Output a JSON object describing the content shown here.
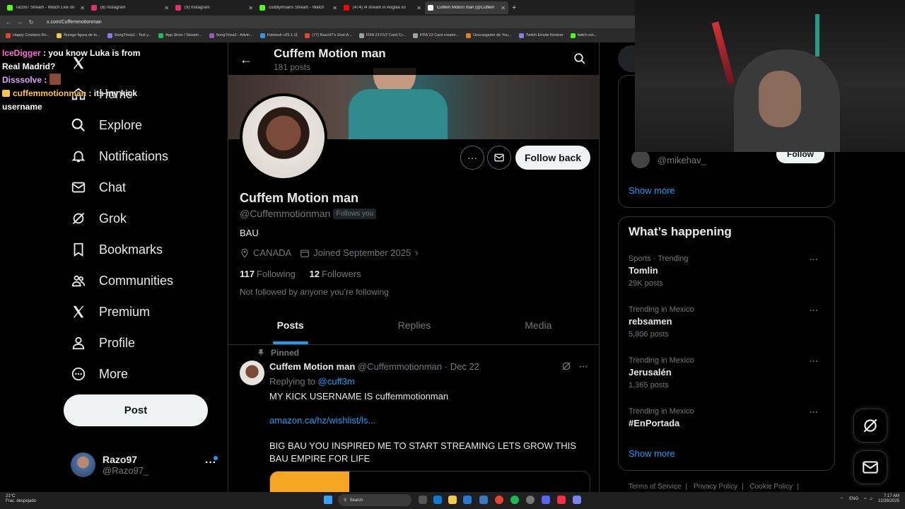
{
  "browser": {
    "tabs": [
      {
        "label": "razo97 Stream - Watch Live on",
        "color": "#53fc18",
        "active": false
      },
      {
        "label": "(6) Instagram",
        "color": "#e1306c",
        "active": false
      },
      {
        "label": "(9) Instagram",
        "color": "#e1306c",
        "active": false
      },
      {
        "label": "cuddlymoans Stream - Watch",
        "color": "#53fc18",
        "active": false
      },
      {
        "label": "(474) i4 stream in Angola xo",
        "color": "#ff0000",
        "active": false
      },
      {
        "label": "Cuffem Motion man (@Cuffem",
        "color": "#ffffff",
        "active": true
      }
    ],
    "url": "x.com/Cuffemmotionman",
    "bookmarks": [
      "Happy Cristiano Ro...",
      "Burago figura de to...",
      "SongTrivia2 - Test y...",
      "App Store / Stream...",
      "SongTrivia2 - Advin...",
      "Feletoob v25.1.11",
      "(77) Razo97's Zest-A...",
      "FIFA 23 FUT Card Cr...",
      "FIFA 23 Card creator...",
      "Descargador de You...",
      "Twitch Emote Resizer",
      "twitch em..."
    ]
  },
  "chat": [
    {
      "user": "IceDigger",
      "text": ": you know Luka is from Real Madrid?"
    },
    {
      "user": "Disssolve",
      "text": ":"
    },
    {
      "user": "cuffemmotionman",
      "text": ": its my kick username"
    }
  ],
  "nav": {
    "items": [
      {
        "label": "Home",
        "icon": "home-icon"
      },
      {
        "label": "Explore",
        "icon": "search-icon"
      },
      {
        "label": "Notifications",
        "icon": "bell-icon"
      },
      {
        "label": "Chat",
        "icon": "mail-icon"
      },
      {
        "label": "Grok",
        "icon": "grok-icon"
      },
      {
        "label": "Bookmarks",
        "icon": "bookmark-icon"
      },
      {
        "label": "Communities",
        "icon": "people-icon"
      },
      {
        "label": "Premium",
        "icon": "x-logo-icon"
      },
      {
        "label": "Profile",
        "icon": "person-icon"
      },
      {
        "label": "More",
        "icon": "more-circle-icon"
      }
    ],
    "post_label": "Post",
    "account": {
      "name": "Razo97",
      "handle": "@Razo97_"
    }
  },
  "profile": {
    "header_name": "Cuffem Motion man",
    "post_count": "181 posts",
    "name": "Cuffem Motion man",
    "handle": "@Cuffemmotionman",
    "follows_you": "Follows you",
    "bio": "BAU",
    "location": "CANADA",
    "joined": "Joined September 2025",
    "following_count": "117",
    "following_label": "Following",
    "followers_count": "12",
    "followers_label": "Followers",
    "not_followed": "Not followed by anyone you’re following",
    "follow_back": "Follow back",
    "tabs": [
      "Posts",
      "Replies",
      "Media"
    ]
  },
  "tweet": {
    "pinned": "Pinned",
    "name": "Cuffem Motion man",
    "handle": "@Cuffemmotionman",
    "sep": "·",
    "date": "Dec 22",
    "replying_prefix": "Replying to",
    "replying_to": "@cuff3m",
    "line1": "MY KICK USERNAME IS cuffemmotionman",
    "link": "amazon.ca/hz/wishlist/ls...",
    "line2": "BIG BAU YOU INSPIRED ME TO START STREAMING LETS GROW THIS BAU EMPIRE FOR LIFE"
  },
  "sidebar": {
    "who_to_follow": {
      "handle": "@mikehav_",
      "follow_label": "Follow",
      "show_more": "Show more"
    },
    "whats_happening": {
      "title": "What’s happening",
      "trends": [
        {
          "context": "Sports · Trending",
          "name": "Tomlin",
          "count": "29K posts"
        },
        {
          "context": "Trending in Mexico",
          "name": "rebsamen",
          "count": "5,906 posts"
        },
        {
          "context": "Trending in Mexico",
          "name": "Jerusalén",
          "count": "1,365 posts"
        },
        {
          "context": "Trending in Mexico",
          "name": "#EnPortada",
          "count": ""
        }
      ],
      "show_more": "Show more"
    },
    "footer": [
      "Terms of Service",
      "Privacy Policy",
      "Cookie Policy"
    ]
  },
  "taskbar": {
    "weather_temp": "21°C",
    "weather_desc": "Frac. despejado",
    "search": "Search",
    "lang": "ENG",
    "time": "7:17 AM",
    "date": "12/28/2025"
  },
  "colors": {
    "accent": "#1d9bf0",
    "bg": "#000000",
    "border": "#2f3336",
    "muted": "#71767b"
  }
}
